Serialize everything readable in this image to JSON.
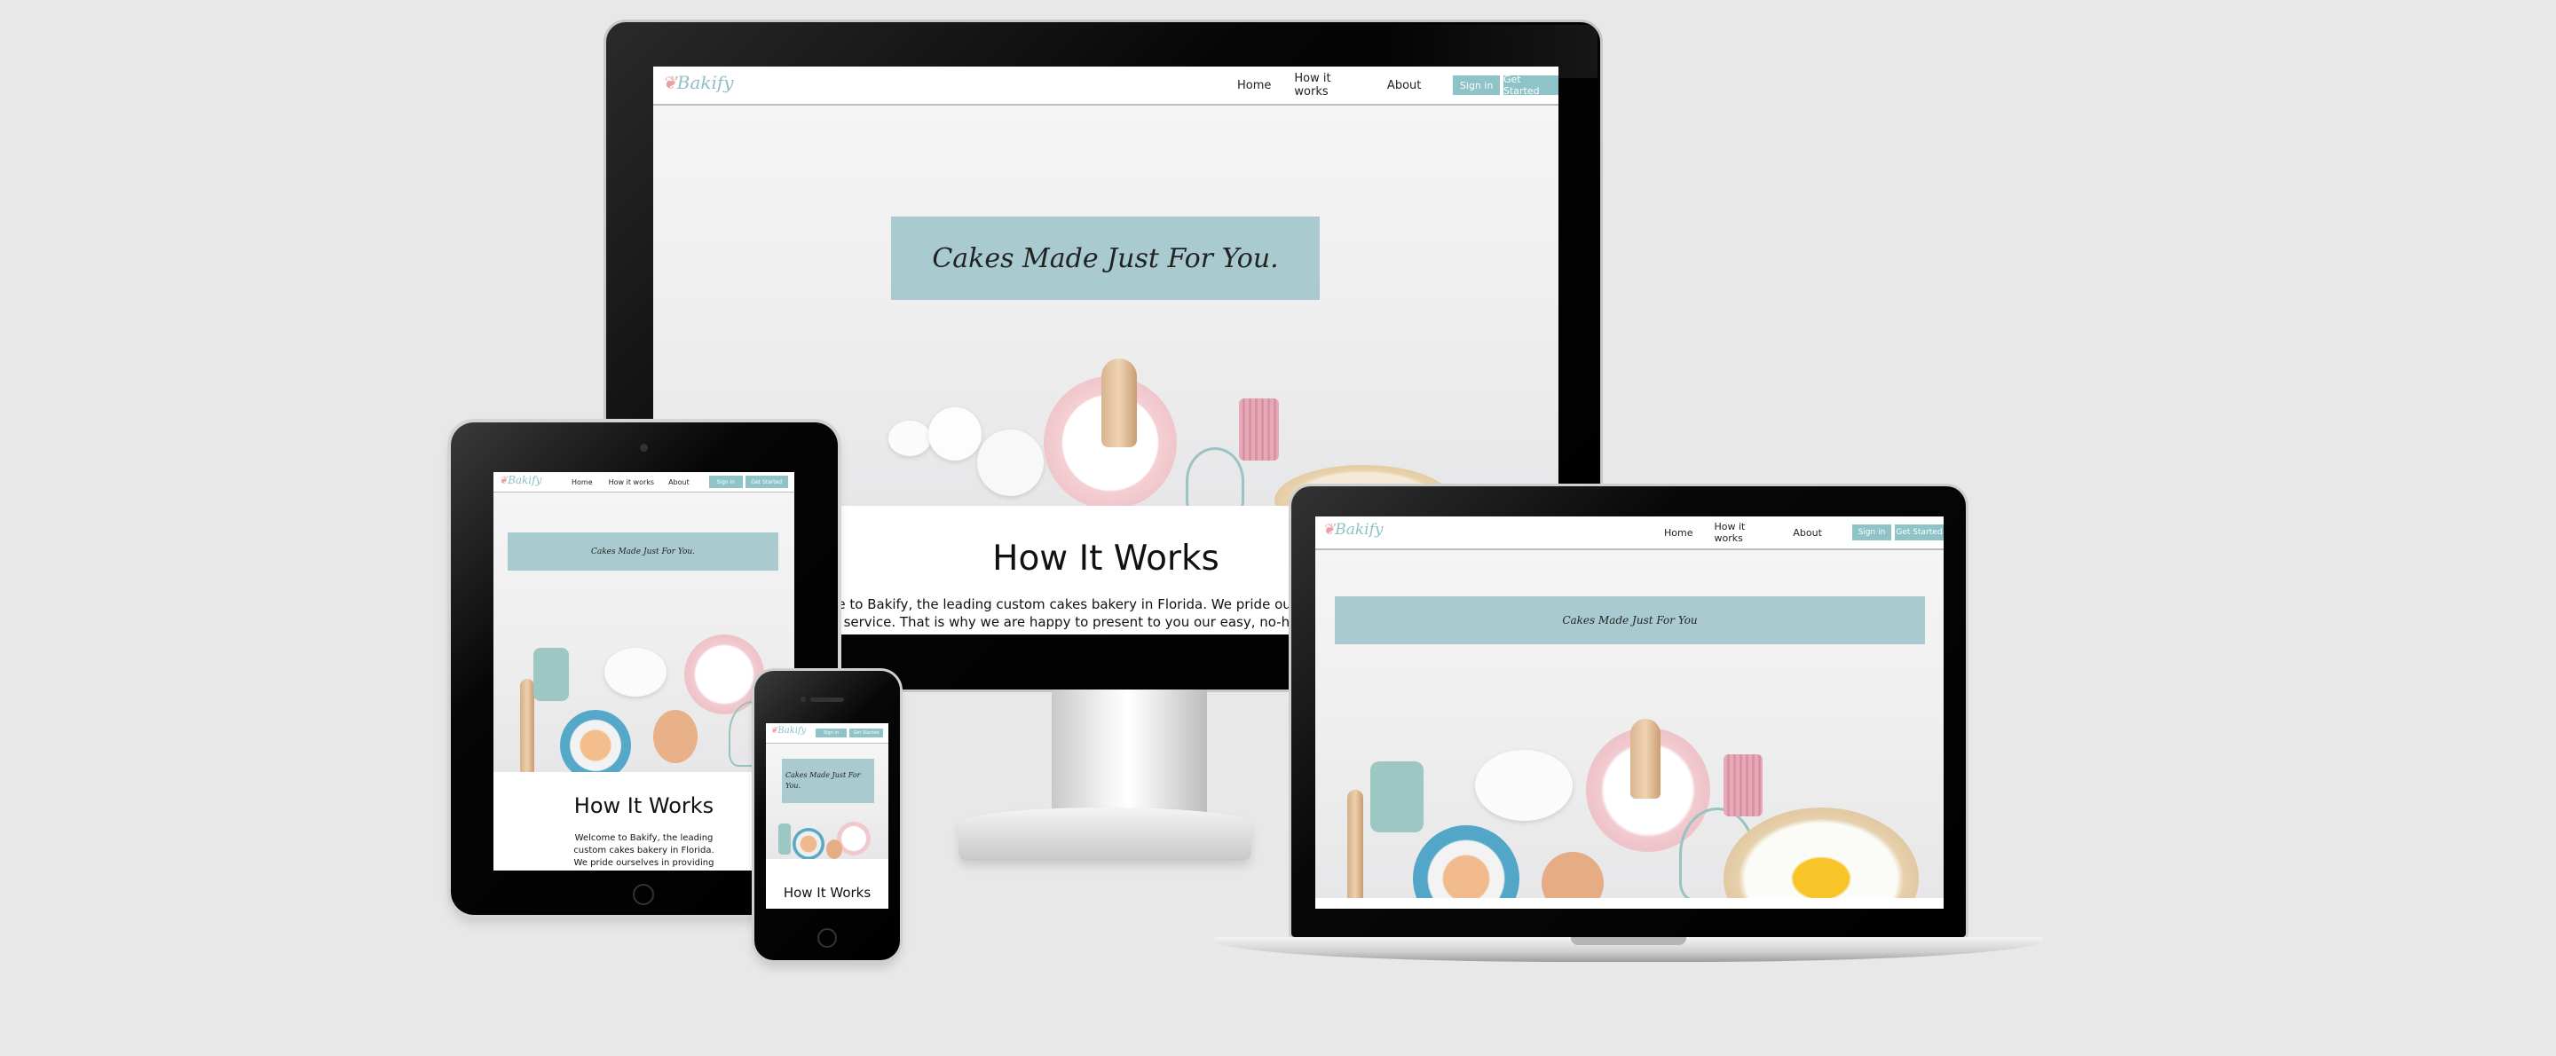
{
  "site": {
    "logo_text": "Bakify",
    "nav": {
      "home": "Home",
      "how": "How it works",
      "about": "About",
      "sign_in": "Sign in",
      "get_started": "Get Started"
    },
    "banner": "Cakes Made Just For You.",
    "banner_short": "Cakes Made Just For You",
    "section_title": "How It Works",
    "desktop_line1": "Welcome to Bakify, the leading custom cakes bakery in Florida. We pride ourselves in providing",
    "desktop_line2": "the best service. That is why we are happy to present to you our easy, no-hassle ordering",
    "tablet_line1": "Welcome to Bakify, the leading",
    "tablet_line2": "custom cakes bakery in Florida.",
    "tablet_line3": "We pride ourselves in providing"
  }
}
